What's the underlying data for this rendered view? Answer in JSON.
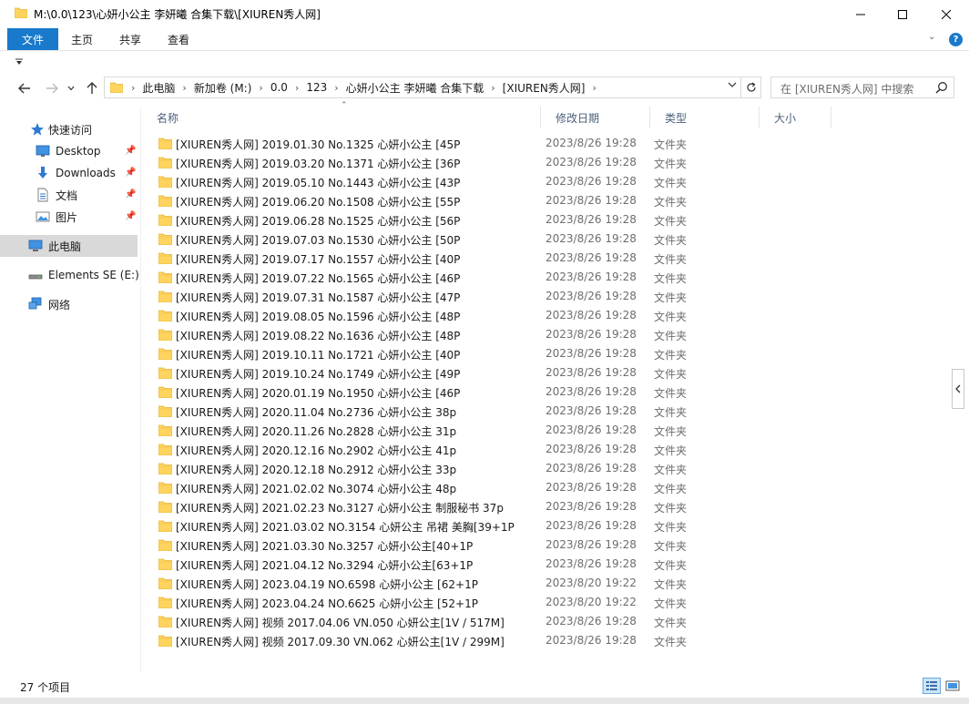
{
  "window": {
    "title": "M:\\0.0\\123\\心妍小公主 李妍曦 合集下载\\[XIUREN秀人网]"
  },
  "ribbon": {
    "tabs": [
      "文件",
      "主页",
      "共享",
      "查看"
    ],
    "help_label": "?"
  },
  "address": {
    "crumbs": [
      "此电脑",
      "新加卷 (M:)",
      "0.0",
      "123",
      "心妍小公主 李妍曦 合集下载",
      "[XIUREN秀人网]"
    ]
  },
  "search": {
    "placeholder": "在 [XIUREN秀人网] 中搜索"
  },
  "sidebar": {
    "items": [
      {
        "label": "快速访问"
      },
      {
        "label": "Desktop"
      },
      {
        "label": "Downloads"
      },
      {
        "label": "文档"
      },
      {
        "label": "图片"
      },
      {
        "label": "此电脑"
      },
      {
        "label": "Elements SE (E:)"
      },
      {
        "label": "网络"
      }
    ]
  },
  "columns": {
    "name": "名称",
    "date": "修改日期",
    "type": "类型",
    "size": "大小"
  },
  "files": [
    {
      "name": "[XIUREN秀人网] 2019.01.30 No.1325 心妍小公主 [45P",
      "date": "2023/8/26 19:28",
      "type": "文件夹"
    },
    {
      "name": "[XIUREN秀人网] 2019.03.20 No.1371 心妍小公主 [36P",
      "date": "2023/8/26 19:28",
      "type": "文件夹"
    },
    {
      "name": "[XIUREN秀人网] 2019.05.10 No.1443 心妍小公主 [43P",
      "date": "2023/8/26 19:28",
      "type": "文件夹"
    },
    {
      "name": "[XIUREN秀人网] 2019.06.20 No.1508 心妍小公主 [55P",
      "date": "2023/8/26 19:28",
      "type": "文件夹"
    },
    {
      "name": "[XIUREN秀人网] 2019.06.28 No.1525 心妍小公主 [56P",
      "date": "2023/8/26 19:28",
      "type": "文件夹"
    },
    {
      "name": "[XIUREN秀人网] 2019.07.03 No.1530 心妍小公主 [50P",
      "date": "2023/8/26 19:28",
      "type": "文件夹"
    },
    {
      "name": "[XIUREN秀人网] 2019.07.17 No.1557 心妍小公主 [40P",
      "date": "2023/8/26 19:28",
      "type": "文件夹"
    },
    {
      "name": "[XIUREN秀人网] 2019.07.22 No.1565 心妍小公主 [46P",
      "date": "2023/8/26 19:28",
      "type": "文件夹"
    },
    {
      "name": "[XIUREN秀人网] 2019.07.31 No.1587 心妍小公主 [47P",
      "date": "2023/8/26 19:28",
      "type": "文件夹"
    },
    {
      "name": "[XIUREN秀人网] 2019.08.05 No.1596 心妍小公主 [48P",
      "date": "2023/8/26 19:28",
      "type": "文件夹"
    },
    {
      "name": "[XIUREN秀人网] 2019.08.22 No.1636 心妍小公主 [48P",
      "date": "2023/8/26 19:28",
      "type": "文件夹"
    },
    {
      "name": "[XIUREN秀人网] 2019.10.11 No.1721 心妍小公主 [40P",
      "date": "2023/8/26 19:28",
      "type": "文件夹"
    },
    {
      "name": "[XIUREN秀人网] 2019.10.24 No.1749 心妍小公主 [49P",
      "date": "2023/8/26 19:28",
      "type": "文件夹"
    },
    {
      "name": "[XIUREN秀人网] 2020.01.19 No.1950 心妍小公主 [46P",
      "date": "2023/8/26 19:28",
      "type": "文件夹"
    },
    {
      "name": "[XIUREN秀人网] 2020.11.04 No.2736 心妍小公主 38p",
      "date": "2023/8/26 19:28",
      "type": "文件夹"
    },
    {
      "name": "[XIUREN秀人网] 2020.11.26 No.2828 心妍小公主 31p",
      "date": "2023/8/26 19:28",
      "type": "文件夹"
    },
    {
      "name": "[XIUREN秀人网] 2020.12.16 No.2902 心妍小公主 41p",
      "date": "2023/8/26 19:28",
      "type": "文件夹"
    },
    {
      "name": "[XIUREN秀人网] 2020.12.18 No.2912 心妍小公主 33p",
      "date": "2023/8/26 19:28",
      "type": "文件夹"
    },
    {
      "name": "[XIUREN秀人网] 2021.02.02 No.3074 心妍小公主 48p",
      "date": "2023/8/26 19:28",
      "type": "文件夹"
    },
    {
      "name": "[XIUREN秀人网] 2021.02.23 No.3127 心妍小公主 制服秘书 37p",
      "date": "2023/8/26 19:28",
      "type": "文件夹"
    },
    {
      "name": "[XIUREN秀人网] 2021.03.02 NO.3154 心妍公主 吊裙 美胸[39+1P",
      "date": "2023/8/26 19:28",
      "type": "文件夹"
    },
    {
      "name": "[XIUREN秀人网] 2021.03.30 No.3257 心妍小公主[40+1P",
      "date": "2023/8/26 19:28",
      "type": "文件夹"
    },
    {
      "name": "[XIUREN秀人网] 2021.04.12 No.3294 心妍小公主[63+1P",
      "date": "2023/8/26 19:28",
      "type": "文件夹"
    },
    {
      "name": "[XIUREN秀人网] 2023.04.19 NO.6598 心妍小公主 [62+1P",
      "date": "2023/8/20 19:22",
      "type": "文件夹"
    },
    {
      "name": "[XIUREN秀人网] 2023.04.24 NO.6625 心妍小公主 [52+1P",
      "date": "2023/8/20 19:22",
      "type": "文件夹"
    },
    {
      "name": "[XIUREN秀人网] 视频 2017.04.06 VN.050 心妍公主[1V / 517M]",
      "date": "2023/8/26 19:28",
      "type": "文件夹"
    },
    {
      "name": "[XIUREN秀人网] 视频 2017.09.30 VN.062 心妍公主[1V / 299M]",
      "date": "2023/8/26 19:28",
      "type": "文件夹"
    }
  ],
  "status": {
    "item_count": "27 个项目"
  },
  "colors": {
    "accent": "#1979ca",
    "folder": "#ffd45e",
    "header_text": "#4c607a",
    "secondary_text": "#6d6d6d"
  }
}
